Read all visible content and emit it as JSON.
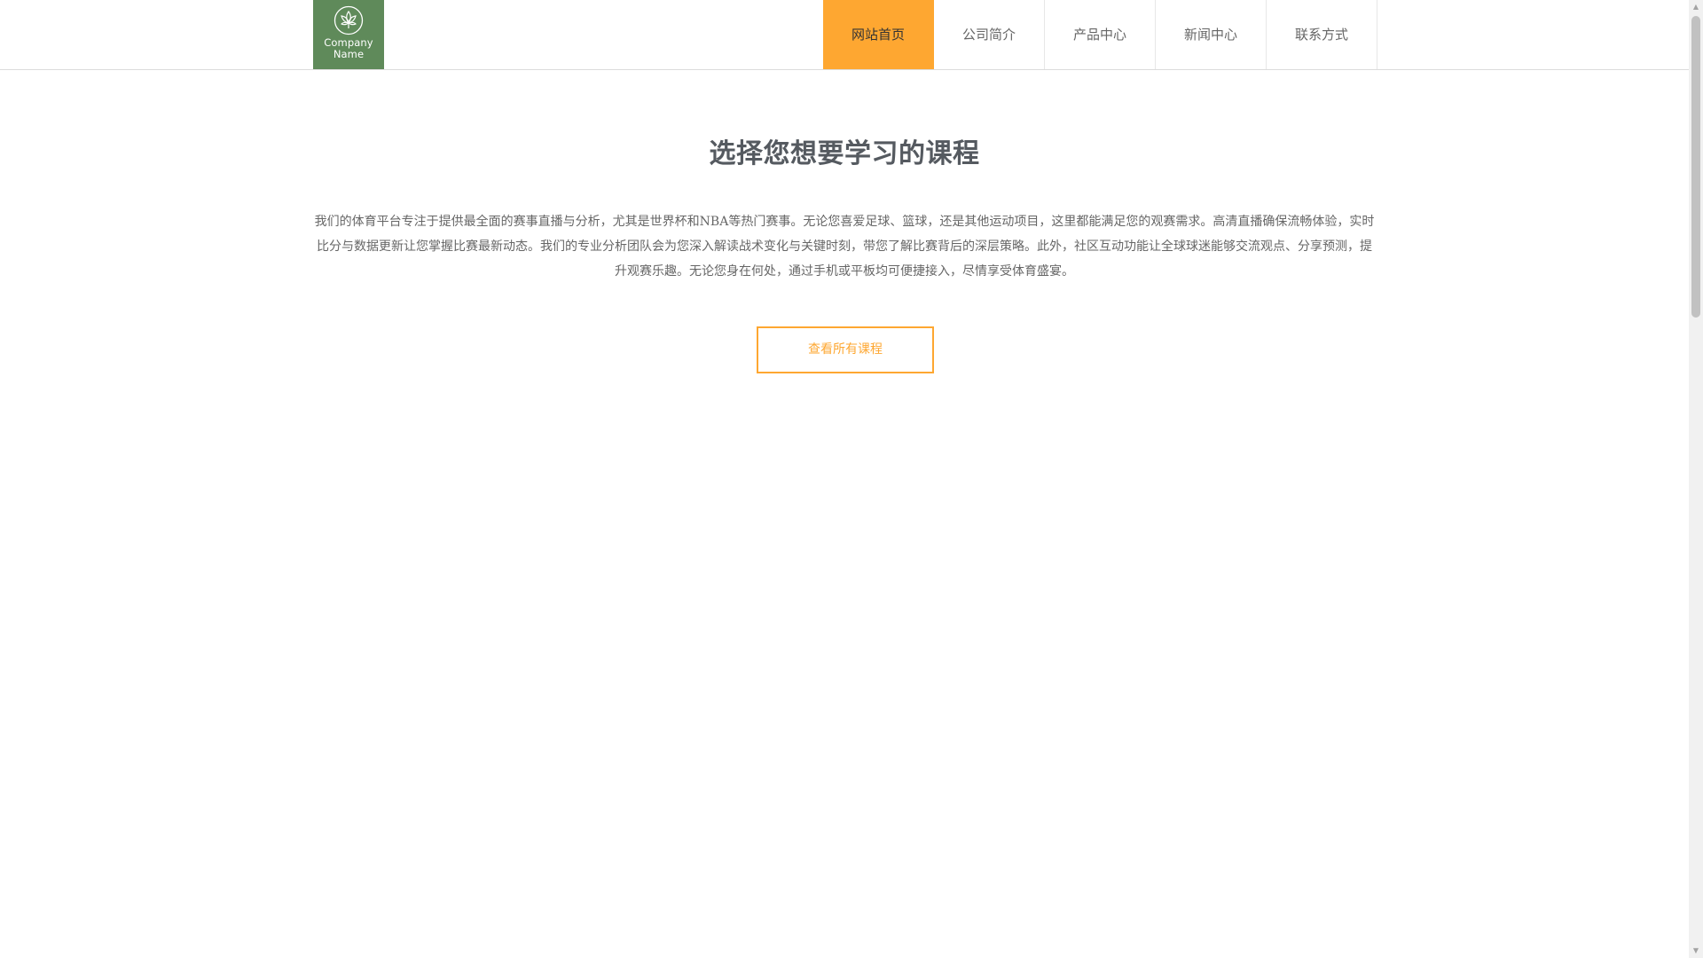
{
  "header": {
    "logo": {
      "icon": "leaf-emblem-icon",
      "text": "Company Name",
      "bg_color": "#5f8a5a"
    },
    "nav": {
      "items": [
        {
          "label": "网站首页",
          "active": true
        },
        {
          "label": "公司简介",
          "active": false
        },
        {
          "label": "产品中心",
          "active": false
        },
        {
          "label": "新闻中心",
          "active": false
        },
        {
          "label": "联系方式",
          "active": false
        }
      ],
      "active_color": "#fea731"
    }
  },
  "main": {
    "headline": "选择您想要学习的课程",
    "description": "我们的体育平台专注于提供最全面的赛事直播与分析，尤其是世界杯和NBA等热门赛事。无论您喜爱足球、篮球，还是其他运动项目，这里都能满足您的观赛需求。高清直播确保流畅体验，实时比分与数据更新让您掌握比赛最新动态。我们的专业分析团队会为您深入解读战术变化与关键时刻，带您了解比赛背后的深层策略。此外，社区互动功能让全球球迷能够交流观点、分享预测，提升观赛乐趣。无论您身在何处，通过手机或平板均可便捷接入，尽情享受体育盛宴。",
    "cta_label": "查看所有课程",
    "accent_color": "#fea731"
  },
  "scrollbar": {
    "up_icon": "scroll-up-arrow-icon",
    "down_icon": "scroll-down-arrow-icon"
  }
}
